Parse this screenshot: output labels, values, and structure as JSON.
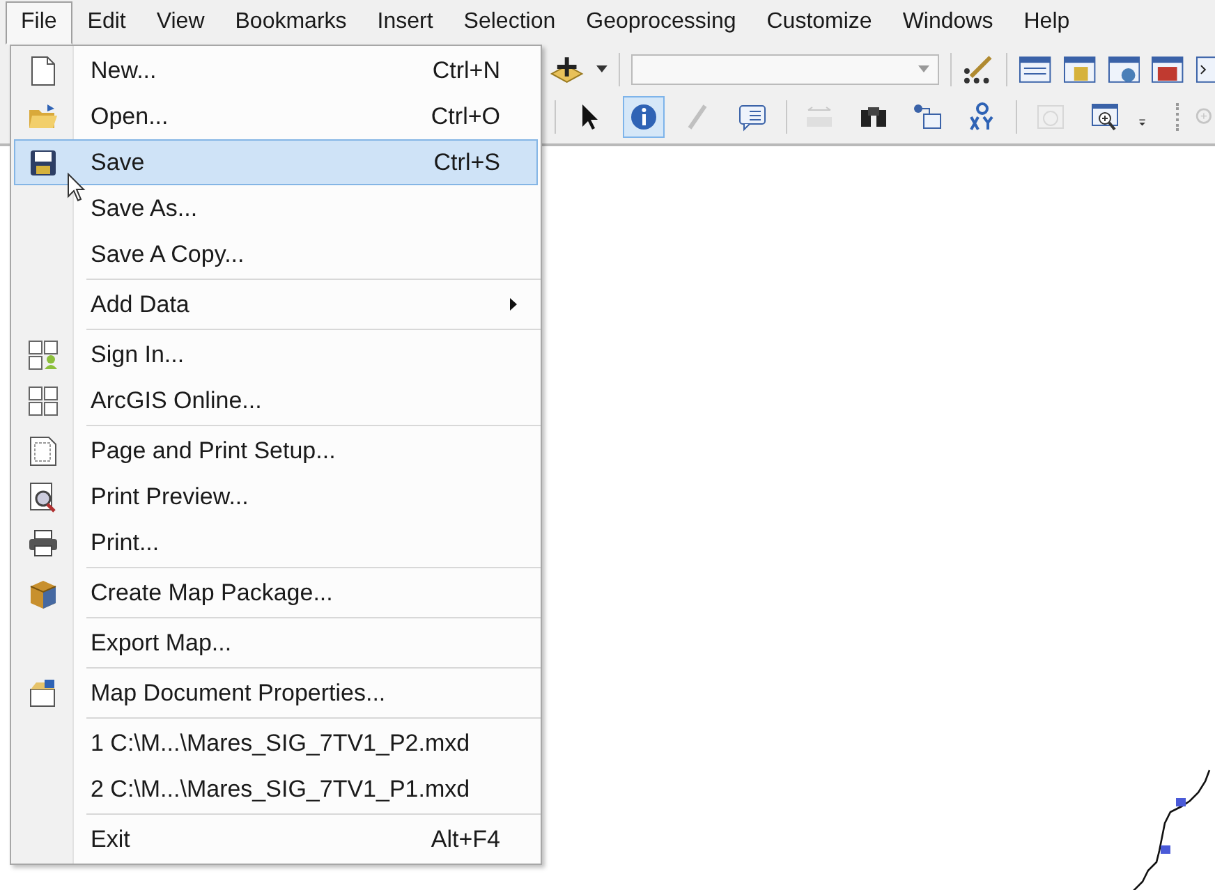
{
  "menubar": [
    {
      "label": "File",
      "selected": true
    },
    {
      "label": "Edit",
      "selected": false
    },
    {
      "label": "View",
      "selected": false
    },
    {
      "label": "Bookmarks",
      "selected": false
    },
    {
      "label": "Insert",
      "selected": false
    },
    {
      "label": "Selection",
      "selected": false
    },
    {
      "label": "Geoprocessing",
      "selected": false
    },
    {
      "label": "Customize",
      "selected": false
    },
    {
      "label": "Windows",
      "selected": false
    },
    {
      "label": "Help",
      "selected": false
    }
  ],
  "tools_row_2": [
    {
      "selected": false,
      "disabled": false
    },
    {
      "selected": true,
      "disabled": false
    },
    {
      "selected": false,
      "disabled": true
    },
    {
      "selected": false,
      "disabled": false
    },
    {
      "selected": false,
      "disabled": true
    },
    {
      "selected": false,
      "disabled": false
    },
    {
      "selected": false,
      "disabled": false
    },
    {
      "selected": false,
      "disabled": false
    },
    {
      "selected": false,
      "disabled": true
    },
    {
      "selected": false,
      "disabled": false
    }
  ],
  "file_menu": {
    "groups": [
      [
        {
          "label": "New...",
          "shortcut": "Ctrl+N",
          "selected": false
        },
        {
          "label": "Open...",
          "shortcut": "Ctrl+O",
          "selected": false
        },
        {
          "label": "Save",
          "shortcut": "Ctrl+S",
          "selected": true
        },
        {
          "label": "Save As...",
          "selected": false
        },
        {
          "label": "Save A Copy...",
          "selected": false
        }
      ],
      [
        {
          "label": "Add Data",
          "submenu": true,
          "selected": false
        }
      ],
      [
        {
          "label": "Sign In...",
          "selected": false
        },
        {
          "label": "ArcGIS Online...",
          "selected": false
        }
      ],
      [
        {
          "label": "Page and Print Setup...",
          "selected": false
        },
        {
          "label": "Print Preview...",
          "selected": false
        },
        {
          "label": "Print...",
          "selected": false
        }
      ],
      [
        {
          "label": "Create Map Package...",
          "selected": false
        }
      ],
      [
        {
          "label": "Export Map...",
          "selected": false
        }
      ],
      [
        {
          "label": "Map Document Properties...",
          "selected": false
        }
      ],
      [
        {
          "label": "1 C:\\M...\\Mares_SIG_7TV1_P2.mxd",
          "selected": false
        },
        {
          "label": "2 C:\\M...\\Mares_SIG_7TV1_P1.mxd",
          "selected": false
        }
      ],
      [
        {
          "label": "Exit",
          "shortcut": "Alt+F4",
          "selected": false
        }
      ]
    ]
  }
}
